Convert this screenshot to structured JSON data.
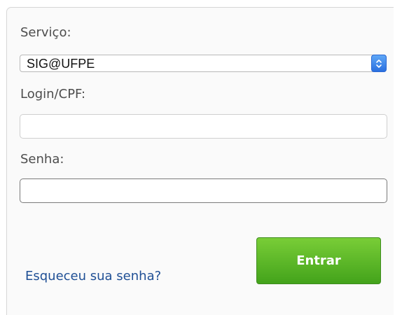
{
  "form": {
    "service_label": "Serviço:",
    "service_selected": "SIG@UFPE",
    "login_label": "Login/CPF:",
    "login_value": "",
    "password_label": "Senha:",
    "password_value": "",
    "forgot_link": "Esqueceu sua senha?",
    "submit_label": "Entrar"
  },
  "icons": {
    "select_arrows": "updown-chevron-icon"
  },
  "colors": {
    "submit_green": "#4caf24",
    "link_blue": "#1f4f95",
    "select_blue": "#3a7ee8"
  }
}
